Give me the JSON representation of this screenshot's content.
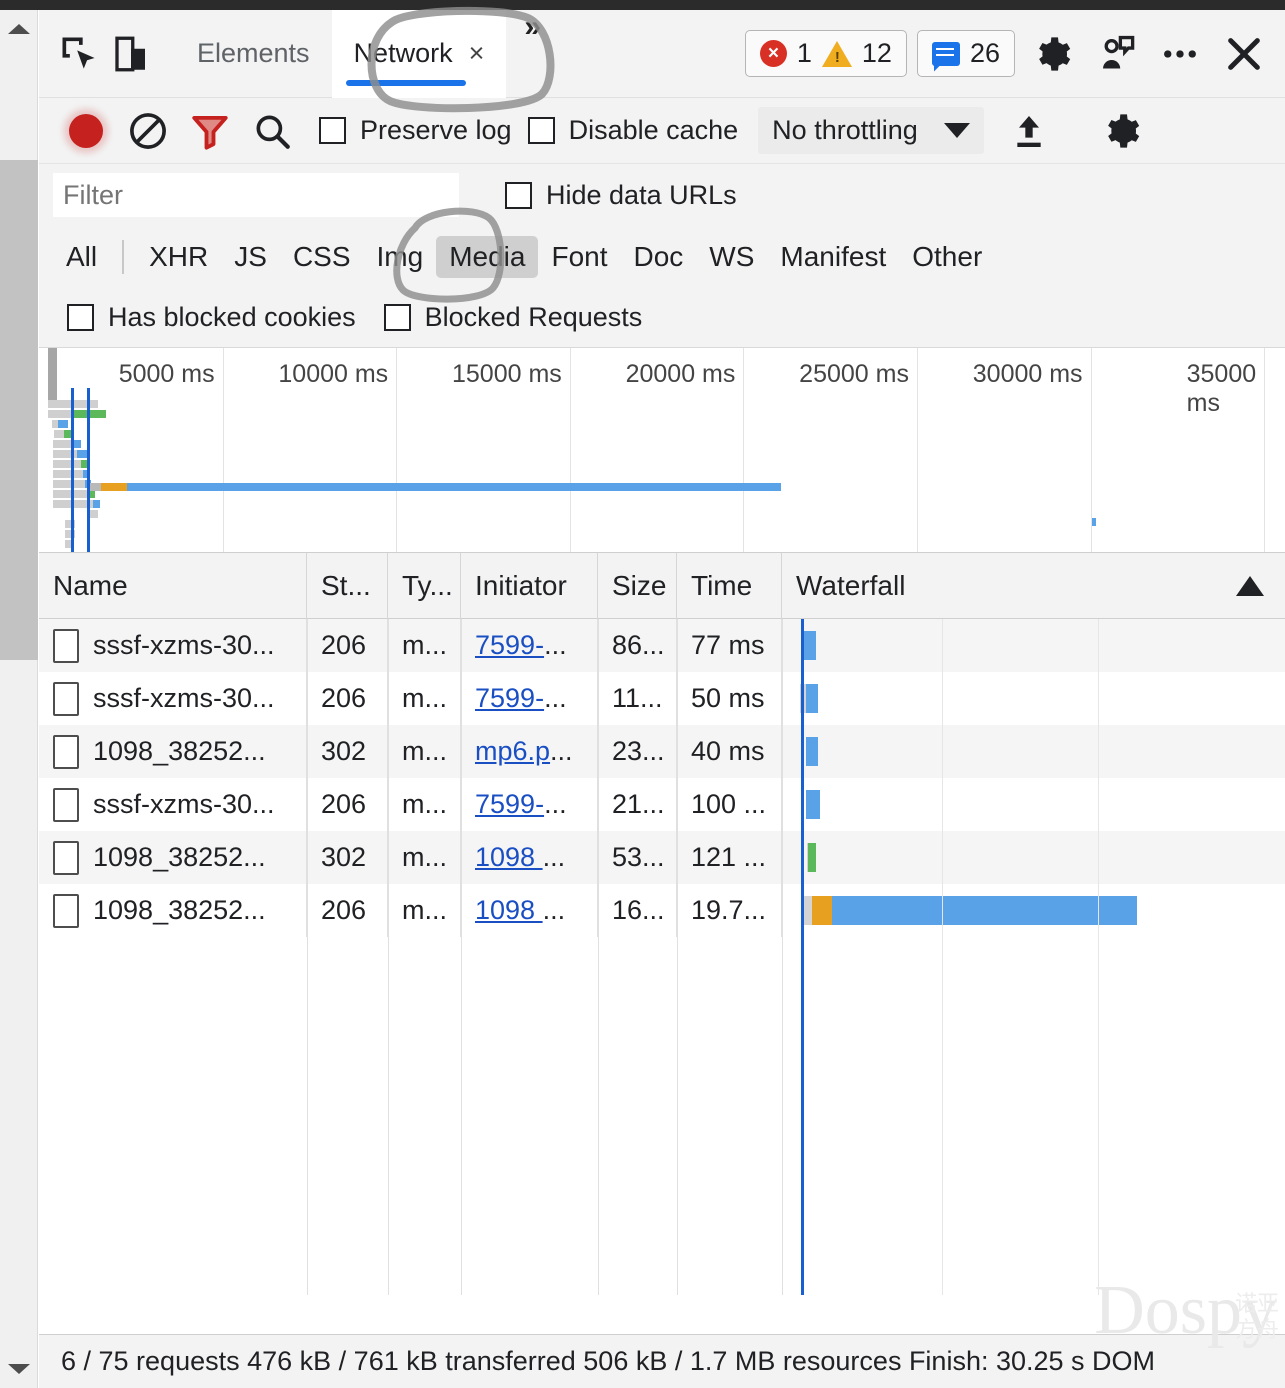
{
  "window": {
    "tabs": [
      {
        "label": "Elements",
        "active": false
      },
      {
        "label": "Network",
        "active": true
      }
    ],
    "tab_close_glyph": "×",
    "more_tabs_glyph": "»",
    "inspect_icon": "inspect-element-icon",
    "device_icon": "device-toolbar-icon",
    "errors_count": "1",
    "warnings_count": "12",
    "messages_count": "26",
    "settings_icon": "gear-icon",
    "account_icon": "user-feedback-icon",
    "more_icon": "more-options-icon",
    "close_icon": "close-icon"
  },
  "toolbar": {
    "record_title": "record-button",
    "clear_title": "clear-button",
    "filter_title": "filter-button",
    "search_title": "search-button",
    "preserve_log_label": "Preserve log",
    "preserve_log_checked": false,
    "disable_cache_label": "Disable cache",
    "disable_cache_checked": false,
    "throttling_value": "No throttling",
    "import_har_title": "import-har-icon",
    "settings_title": "network-settings-icon"
  },
  "filter": {
    "placeholder": "Filter",
    "value": "",
    "hide_data_urls_label": "Hide data URLs",
    "hide_data_urls_checked": false,
    "types": [
      {
        "label": "All",
        "selected": false
      },
      {
        "label": "XHR",
        "selected": false
      },
      {
        "label": "JS",
        "selected": false
      },
      {
        "label": "CSS",
        "selected": false
      },
      {
        "label": "Img",
        "selected": false
      },
      {
        "label": "Media",
        "selected": true
      },
      {
        "label": "Font",
        "selected": false
      },
      {
        "label": "Doc",
        "selected": false
      },
      {
        "label": "WS",
        "selected": false
      },
      {
        "label": "Manifest",
        "selected": false
      },
      {
        "label": "Other",
        "selected": false
      }
    ],
    "has_blocked_cookies_label": "Has blocked cookies",
    "has_blocked_cookies_checked": false,
    "blocked_requests_label": "Blocked Requests",
    "blocked_requests_checked": false
  },
  "overview": {
    "ticks": [
      "5000 ms",
      "10000 ms",
      "15000 ms",
      "20000 ms",
      "25000 ms",
      "30000 ms",
      "35000 ms"
    ]
  },
  "table": {
    "columns": [
      "Name",
      "St...",
      "Ty...",
      "Initiator",
      "Size",
      "Time",
      "Waterfall"
    ],
    "sort_indicator": "sort-ascending-icon",
    "rows": [
      {
        "name": "sssf-xzms-30...",
        "status": "206",
        "type": "m...",
        "initiator": "7599-",
        "initiator_more": "...",
        "size": "86...",
        "time": "77 ms"
      },
      {
        "name": "sssf-xzms-30...",
        "status": "206",
        "type": "m...",
        "initiator": "7599-",
        "initiator_more": "...",
        "size": "11...",
        "time": "50 ms"
      },
      {
        "name": "1098_38252...",
        "status": "302",
        "type": "m...",
        "initiator": "mp6.p",
        "initiator_more": "...",
        "size": "23...",
        "time": "40 ms"
      },
      {
        "name": "sssf-xzms-30...",
        "status": "206",
        "type": "m...",
        "initiator": "7599-",
        "initiator_more": "...",
        "size": "21...",
        "time": "100 ..."
      },
      {
        "name": "1098_38252...",
        "status": "302",
        "type": "m...",
        "initiator": "1098 ",
        "initiator_more": "...",
        "size": "53...",
        "time": "121 ..."
      },
      {
        "name": "1098_38252...",
        "status": "206",
        "type": "m...",
        "initiator": "1098 ",
        "initiator_more": "...",
        "size": "16...",
        "time": "19.7..."
      }
    ]
  },
  "status": {
    "summary": "6 / 75 requests   476 kB / 761 kB transferred   506 kB / 1.7 MB resources   Finish: 30.25 s   DOM"
  },
  "watermark": {
    "text": "Dospy",
    "text_cn_line1": "诺亚",
    "text_cn_line2": "方舟"
  },
  "colors": {
    "accent": "#1a73e8",
    "record_red": "#c5221f",
    "filter_red": "#c5221f",
    "link": "#1a4fc4",
    "waterfall_blue": "#5aa2e8",
    "waterfall_orange": "#e8a020",
    "waterfall_green": "#5bb85b",
    "marker_blue": "#1a5fd0",
    "chip_selected_bg": "#cfcfcf",
    "toolbar_bg": "#f3f3f3"
  }
}
